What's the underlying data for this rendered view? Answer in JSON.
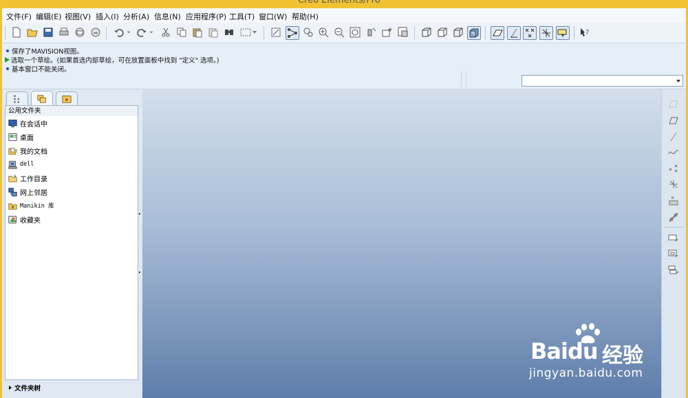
{
  "window": {
    "title": "Creo Elements/Pro"
  },
  "menu": [
    "文件(F)",
    "编辑(E)",
    "视图(V)",
    "插入(I)",
    "分析(A)",
    "信息(N)",
    "应用程序(P)",
    "工具(T)",
    "窗口(W)",
    "帮助(H)"
  ],
  "messages": [
    {
      "type": "info",
      "text": "保存了MAVISION视图。"
    },
    {
      "type": "prompt",
      "text": "选取一个草绘。(如果首选内部草绘，可在放置面板中找到 \"定义\" 选项。)"
    },
    {
      "type": "info",
      "text": "基本窗口不能关闭。"
    }
  ],
  "selector": {
    "value": ""
  },
  "navigator": {
    "header": "公用文件夹",
    "items": [
      {
        "label": "在会话中",
        "icon": "session-monitor-icon"
      },
      {
        "label": "桌面",
        "icon": "desktop-icon"
      },
      {
        "label": "我的文档",
        "icon": "my-documents-icon"
      },
      {
        "label": "dell",
        "icon": "computer-icon"
      },
      {
        "label": "工作目录",
        "icon": "working-directory-icon"
      },
      {
        "label": "网上邻居",
        "icon": "network-icon"
      },
      {
        "label": "Manikin 库",
        "icon": "manikin-library-icon"
      },
      {
        "label": "收藏夹",
        "icon": "favorites-icon"
      }
    ],
    "footer": "文件夹树"
  },
  "watermark": {
    "brand_a": "Bai",
    "brand_b": "du",
    "brand_cn": "经验",
    "url": "jingyan.baidu.com"
  },
  "colors": {
    "accent_frame": "#f1c232",
    "prompt_arrow": "#1a9e2a",
    "info_bullet": "#1d4fb8"
  }
}
